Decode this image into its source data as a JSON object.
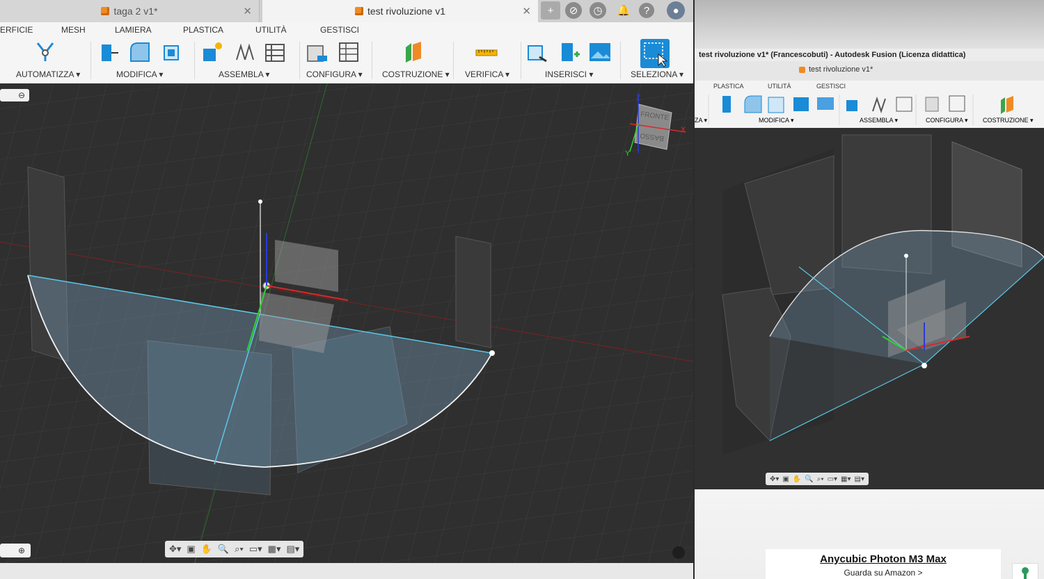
{
  "left_window": {
    "tabs": [
      {
        "label": "taga 2 v1*",
        "active": false
      },
      {
        "label": "test rivoluzione v1",
        "active": true
      }
    ],
    "menu": [
      "ERFICIE",
      "MESH",
      "LAMIERA",
      "PLASTICA",
      "UTILITÀ",
      "GESTISCI"
    ],
    "toolbar_groups": [
      {
        "label": "AUTOMATIZZA ▾"
      },
      {
        "label": "MODIFICA ▾"
      },
      {
        "label": "ASSEMBLA ▾"
      },
      {
        "label": "CONFIGURA ▾"
      },
      {
        "label": "COSTRUZIONE ▾"
      },
      {
        "label": "VERIFICA ▾"
      },
      {
        "label": "INSERISCI ▾"
      },
      {
        "label": "SELEZIONA ▾"
      }
    ],
    "viewcube": {
      "front": "FRONTE",
      "bottom": "BASSO",
      "axis_z": "Z",
      "axis_y": "Y",
      "axis_x": "X"
    }
  },
  "right_window": {
    "title": "test rivoluzione v1* (Francescobuti) - Autodesk Fusion (Licenza didattica)",
    "tab": "test rivoluzione v1*",
    "menu": [
      "PLASTICA",
      "UTILITÀ",
      "GESTISCI"
    ],
    "toolbar_groups": [
      "ZA ▾",
      "MODIFICA ▾",
      "ASSEMBLA ▾",
      "CONFIGURA ▾",
      "COSTRUZIONE ▾"
    ]
  },
  "ad": {
    "title": "Anycubic Photon M3 Max",
    "subtitle": "Guarda su Amazon >"
  },
  "colors": {
    "accent": "#1a8bd6",
    "tab_orange": "#f08a24",
    "sketch_line": "#5bc8e8"
  }
}
